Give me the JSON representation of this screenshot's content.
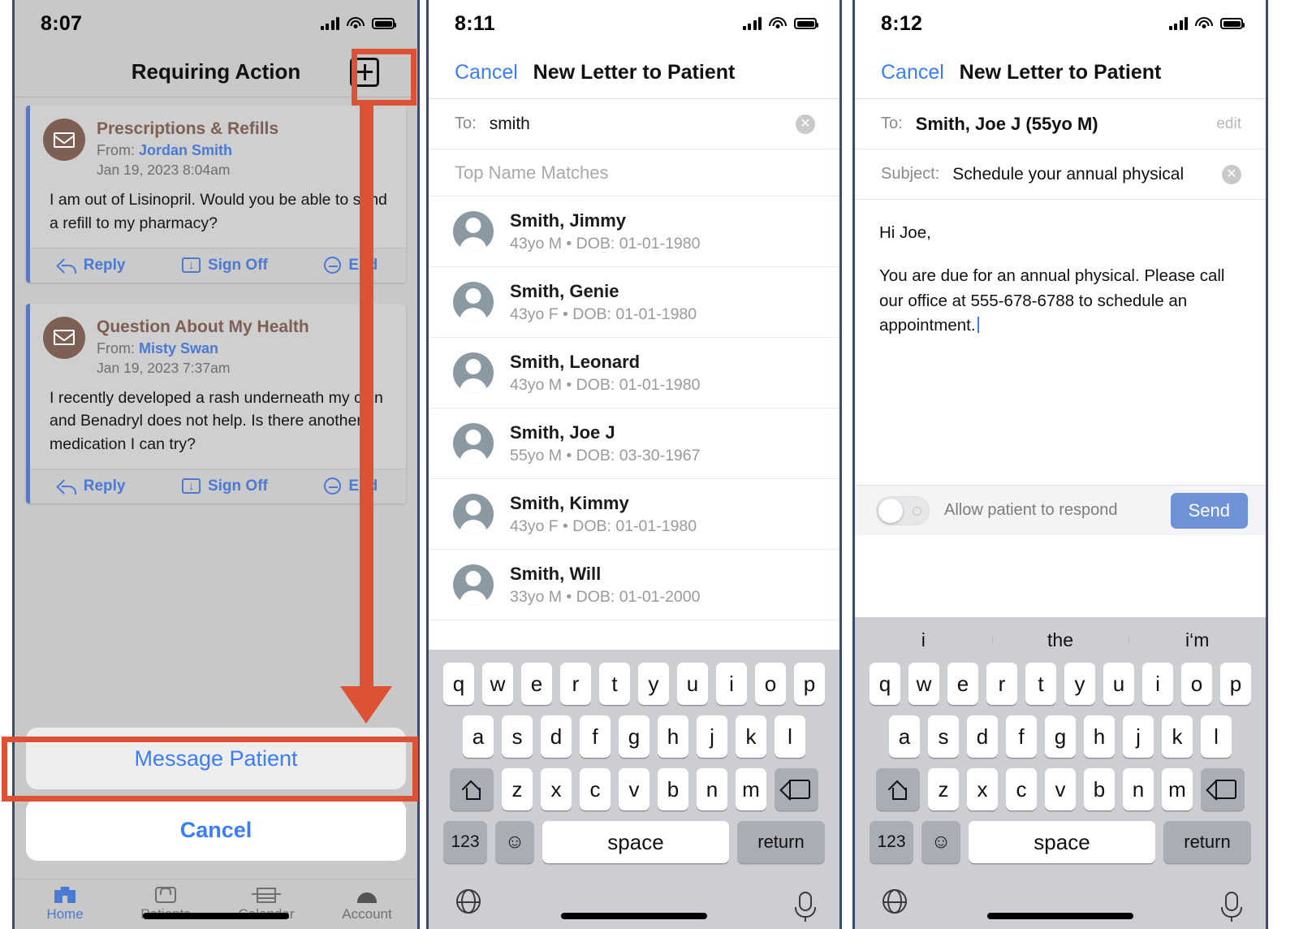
{
  "panel1": {
    "status": {
      "time": "8:07"
    },
    "navbar": {
      "title": "Requiring Action",
      "add_button_icon": "plus-square-icon"
    },
    "messages": [
      {
        "subject": "Prescriptions & Refills",
        "from_label": "From:",
        "from_name": "Jordan Smith",
        "date": "Jan 19, 2023 8:04am",
        "body": "I am out of Lisinopril. Would you be able to send a refill to my pharmacy?",
        "actions": [
          "Reply",
          "Sign Off",
          "End"
        ]
      },
      {
        "subject": "Question About My Health",
        "from_label": "From:",
        "from_name": "Misty Swan",
        "date": "Jan 19, 2023 7:37am",
        "body": "I recently developed a rash underneath my chin and Benadryl does not help. Is there another medication I can try?",
        "actions": [
          "Reply",
          "Sign Off",
          "End"
        ]
      }
    ],
    "sheet": {
      "primary": "Message Patient",
      "cancel": "Cancel"
    },
    "tabs": [
      {
        "label": "Home",
        "icon": "home-icon",
        "active": true
      },
      {
        "label": "Patients",
        "icon": "patients-icon",
        "active": false
      },
      {
        "label": "Calendar",
        "icon": "calendar-icon",
        "active": false
      },
      {
        "label": "Account",
        "icon": "account-icon",
        "active": false
      }
    ]
  },
  "panel2": {
    "status": {
      "time": "8:11"
    },
    "navbar": {
      "cancel": "Cancel",
      "title": "New Letter to Patient"
    },
    "to_field": {
      "label": "To:",
      "value": "smith",
      "clear_icon": "clear-circle-icon"
    },
    "section_header": "Top Name Matches",
    "results": [
      {
        "name": "Smith, Jimmy",
        "detail": "43yo M • DOB: 01-01-1980"
      },
      {
        "name": "Smith, Genie",
        "detail": "43yo F • DOB: 01-01-1980"
      },
      {
        "name": "Smith, Leonard",
        "detail": "43yo M • DOB: 01-01-1980"
      },
      {
        "name": "Smith, Joe J",
        "detail": "55yo M • DOB: 03-30-1967"
      },
      {
        "name": "Smith, Kimmy",
        "detail": "43yo F • DOB: 01-01-1980"
      },
      {
        "name": "Smith, Will",
        "detail": "33yo M • DOB: 01-01-2000"
      }
    ],
    "keyboard": {
      "row1": [
        "q",
        "w",
        "e",
        "r",
        "t",
        "y",
        "u",
        "i",
        "o",
        "p"
      ],
      "row2": [
        "a",
        "s",
        "d",
        "f",
        "g",
        "h",
        "j",
        "k",
        "l"
      ],
      "row3": [
        "z",
        "x",
        "c",
        "v",
        "b",
        "n",
        "m"
      ],
      "shift_icon": "shift-icon",
      "backspace_icon": "backspace-icon",
      "numeric": "123",
      "emoji_icon": "emoji-icon",
      "space": "space",
      "return": "return",
      "globe_icon": "globe-icon",
      "mic_icon": "microphone-icon"
    }
  },
  "panel3": {
    "status": {
      "time": "8:12"
    },
    "navbar": {
      "cancel": "Cancel",
      "title": "New Letter to Patient"
    },
    "to_field": {
      "label": "To:",
      "value": "Smith, Joe J (55yo M)",
      "edit": "edit"
    },
    "subject_field": {
      "label": "Subject:",
      "value": "Schedule your annual physical",
      "clear_icon": "clear-circle-icon"
    },
    "body": {
      "greeting": "Hi Joe,",
      "paragraph": "You are due for an annual physical. Please call our office at 555-678-6788 to schedule an appointment."
    },
    "respond_bar": {
      "toggle_label": "Allow patient to respond",
      "toggle_state": "off",
      "send": "Send"
    },
    "predictive": [
      "i",
      "the",
      "i‘m"
    ],
    "keyboard": {
      "row1": [
        "q",
        "w",
        "e",
        "r",
        "t",
        "y",
        "u",
        "i",
        "o",
        "p"
      ],
      "row2": [
        "a",
        "s",
        "d",
        "f",
        "g",
        "h",
        "j",
        "k",
        "l"
      ],
      "row3": [
        "z",
        "x",
        "c",
        "v",
        "b",
        "n",
        "m"
      ],
      "shift_icon": "shift-icon",
      "backspace_icon": "backspace-icon",
      "numeric": "123",
      "emoji_icon": "emoji-icon",
      "space": "space",
      "return": "return",
      "globe_icon": "globe-icon",
      "mic_icon": "microphone-icon"
    }
  },
  "annotations": {
    "accent_color": "#dd5134",
    "highlights": [
      "add-button-highlight",
      "message-patient-highlight"
    ],
    "arrow": "add-button-to-message-patient-arrow"
  }
}
